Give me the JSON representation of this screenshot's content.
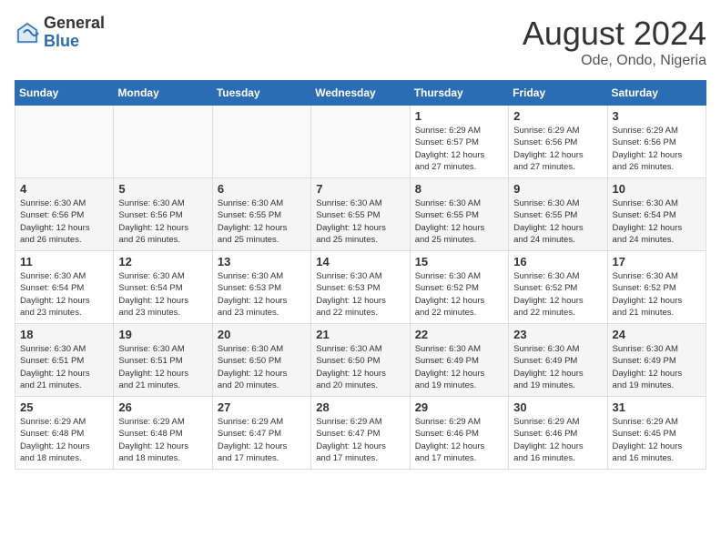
{
  "header": {
    "logo_general": "General",
    "logo_blue": "Blue",
    "month_year": "August 2024",
    "location": "Ode, Ondo, Nigeria"
  },
  "days_of_week": [
    "Sunday",
    "Monday",
    "Tuesday",
    "Wednesday",
    "Thursday",
    "Friday",
    "Saturday"
  ],
  "weeks": [
    [
      {
        "day": "",
        "info": ""
      },
      {
        "day": "",
        "info": ""
      },
      {
        "day": "",
        "info": ""
      },
      {
        "day": "",
        "info": ""
      },
      {
        "day": "1",
        "info": "Sunrise: 6:29 AM\nSunset: 6:57 PM\nDaylight: 12 hours\nand 27 minutes."
      },
      {
        "day": "2",
        "info": "Sunrise: 6:29 AM\nSunset: 6:56 PM\nDaylight: 12 hours\nand 27 minutes."
      },
      {
        "day": "3",
        "info": "Sunrise: 6:29 AM\nSunset: 6:56 PM\nDaylight: 12 hours\nand 26 minutes."
      }
    ],
    [
      {
        "day": "4",
        "info": "Sunrise: 6:30 AM\nSunset: 6:56 PM\nDaylight: 12 hours\nand 26 minutes."
      },
      {
        "day": "5",
        "info": "Sunrise: 6:30 AM\nSunset: 6:56 PM\nDaylight: 12 hours\nand 26 minutes."
      },
      {
        "day": "6",
        "info": "Sunrise: 6:30 AM\nSunset: 6:55 PM\nDaylight: 12 hours\nand 25 minutes."
      },
      {
        "day": "7",
        "info": "Sunrise: 6:30 AM\nSunset: 6:55 PM\nDaylight: 12 hours\nand 25 minutes."
      },
      {
        "day": "8",
        "info": "Sunrise: 6:30 AM\nSunset: 6:55 PM\nDaylight: 12 hours\nand 25 minutes."
      },
      {
        "day": "9",
        "info": "Sunrise: 6:30 AM\nSunset: 6:55 PM\nDaylight: 12 hours\nand 24 minutes."
      },
      {
        "day": "10",
        "info": "Sunrise: 6:30 AM\nSunset: 6:54 PM\nDaylight: 12 hours\nand 24 minutes."
      }
    ],
    [
      {
        "day": "11",
        "info": "Sunrise: 6:30 AM\nSunset: 6:54 PM\nDaylight: 12 hours\nand 23 minutes."
      },
      {
        "day": "12",
        "info": "Sunrise: 6:30 AM\nSunset: 6:54 PM\nDaylight: 12 hours\nand 23 minutes."
      },
      {
        "day": "13",
        "info": "Sunrise: 6:30 AM\nSunset: 6:53 PM\nDaylight: 12 hours\nand 23 minutes."
      },
      {
        "day": "14",
        "info": "Sunrise: 6:30 AM\nSunset: 6:53 PM\nDaylight: 12 hours\nand 22 minutes."
      },
      {
        "day": "15",
        "info": "Sunrise: 6:30 AM\nSunset: 6:52 PM\nDaylight: 12 hours\nand 22 minutes."
      },
      {
        "day": "16",
        "info": "Sunrise: 6:30 AM\nSunset: 6:52 PM\nDaylight: 12 hours\nand 22 minutes."
      },
      {
        "day": "17",
        "info": "Sunrise: 6:30 AM\nSunset: 6:52 PM\nDaylight: 12 hours\nand 21 minutes."
      }
    ],
    [
      {
        "day": "18",
        "info": "Sunrise: 6:30 AM\nSunset: 6:51 PM\nDaylight: 12 hours\nand 21 minutes."
      },
      {
        "day": "19",
        "info": "Sunrise: 6:30 AM\nSunset: 6:51 PM\nDaylight: 12 hours\nand 21 minutes."
      },
      {
        "day": "20",
        "info": "Sunrise: 6:30 AM\nSunset: 6:50 PM\nDaylight: 12 hours\nand 20 minutes."
      },
      {
        "day": "21",
        "info": "Sunrise: 6:30 AM\nSunset: 6:50 PM\nDaylight: 12 hours\nand 20 minutes."
      },
      {
        "day": "22",
        "info": "Sunrise: 6:30 AM\nSunset: 6:49 PM\nDaylight: 12 hours\nand 19 minutes."
      },
      {
        "day": "23",
        "info": "Sunrise: 6:30 AM\nSunset: 6:49 PM\nDaylight: 12 hours\nand 19 minutes."
      },
      {
        "day": "24",
        "info": "Sunrise: 6:30 AM\nSunset: 6:49 PM\nDaylight: 12 hours\nand 19 minutes."
      }
    ],
    [
      {
        "day": "25",
        "info": "Sunrise: 6:29 AM\nSunset: 6:48 PM\nDaylight: 12 hours\nand 18 minutes."
      },
      {
        "day": "26",
        "info": "Sunrise: 6:29 AM\nSunset: 6:48 PM\nDaylight: 12 hours\nand 18 minutes."
      },
      {
        "day": "27",
        "info": "Sunrise: 6:29 AM\nSunset: 6:47 PM\nDaylight: 12 hours\nand 17 minutes."
      },
      {
        "day": "28",
        "info": "Sunrise: 6:29 AM\nSunset: 6:47 PM\nDaylight: 12 hours\nand 17 minutes."
      },
      {
        "day": "29",
        "info": "Sunrise: 6:29 AM\nSunset: 6:46 PM\nDaylight: 12 hours\nand 17 minutes."
      },
      {
        "day": "30",
        "info": "Sunrise: 6:29 AM\nSunset: 6:46 PM\nDaylight: 12 hours\nand 16 minutes."
      },
      {
        "day": "31",
        "info": "Sunrise: 6:29 AM\nSunset: 6:45 PM\nDaylight: 12 hours\nand 16 minutes."
      }
    ]
  ]
}
